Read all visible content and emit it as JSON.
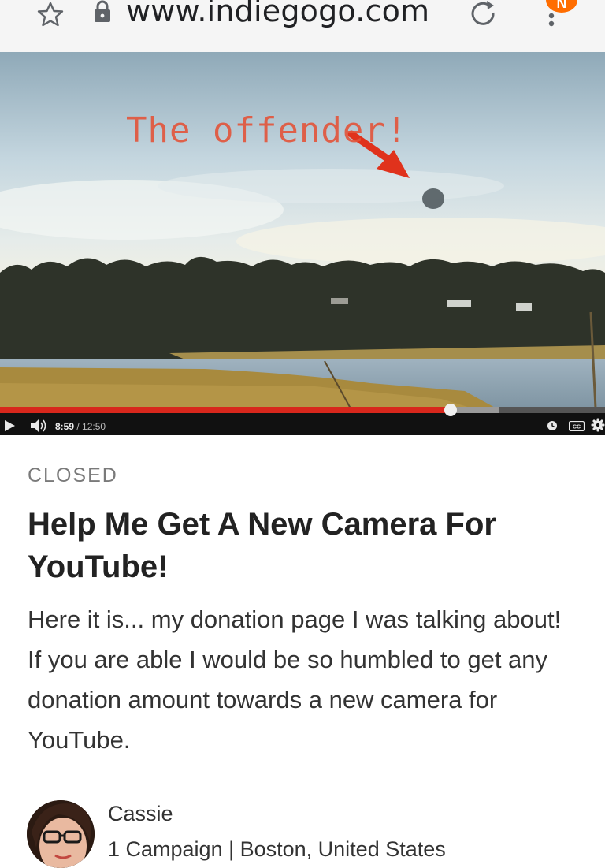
{
  "browser": {
    "url": "www.indiegogo.com",
    "badge": "N"
  },
  "video": {
    "annotation": "The offender!",
    "current_time": "8:59",
    "separator": " / ",
    "total_time": "12:50",
    "progress_played": 0.745,
    "progress_loaded": 0.825
  },
  "campaign": {
    "status": "CLOSED",
    "title": "Help Me Get A New Camera For YouTube!",
    "description": "Here it is... my donation page I was talking about! If you are able I would be so humbled to get any donation amount towards a new camera for YouTube."
  },
  "owner": {
    "name": "Cassie",
    "meta": "1 Campaign | Boston, United States"
  },
  "colors": {
    "progress_red": "#d8271c",
    "badge_orange": "#ff6d00"
  }
}
